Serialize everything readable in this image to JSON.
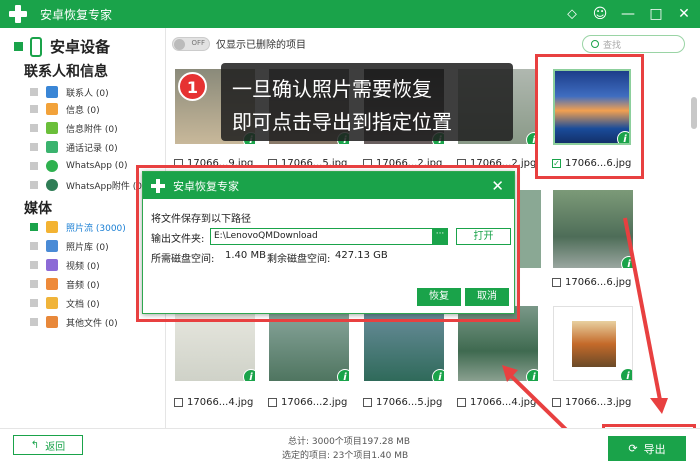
{
  "window": {
    "title": "安卓恢复专家",
    "controls": [
      "⬦",
      "☺",
      "—",
      "□",
      "✕"
    ]
  },
  "sidebar": {
    "device": "安卓设备",
    "group_contacts": "联系人和信息",
    "group_media": "媒体",
    "items": [
      {
        "label": "联系人 (0)",
        "color": "#3a86d6"
      },
      {
        "label": "信息 (0)",
        "color": "#f2a23a"
      },
      {
        "label": "信息附件 (0)",
        "color": "#6bbf3a"
      },
      {
        "label": "通话记录 (0)",
        "color": "#3ab36e"
      },
      {
        "label": "WhatsApp (0)",
        "color": "#2eb14f"
      },
      {
        "label": "WhatsApp附件 (0)",
        "color": "#2f7d56"
      },
      {
        "label": "照片流 (3000)",
        "color": "#f3b332"
      },
      {
        "label": "照片库 (0)",
        "color": "#4a8bd6"
      },
      {
        "label": "视频 (0)",
        "color": "#8c6ad6"
      },
      {
        "label": "音频 (0)",
        "color": "#ee8a3a"
      },
      {
        "label": "文档 (0)",
        "color": "#f0b43a"
      },
      {
        "label": "其他文件 (0)",
        "color": "#e8883a"
      }
    ]
  },
  "toolbar": {
    "toggle_state": "OFF",
    "toggle_label": "仅显示已删除的项目",
    "search_placeholder": "查找"
  },
  "grid": {
    "row1": [
      "17066...9.jpg",
      "17066...5.jpg",
      "17066...2.jpg",
      "17066...2.jpg",
      "17066...6.jpg"
    ],
    "row2": [
      "17066...6.jpg"
    ],
    "row3": [
      "17066...4.jpg",
      "17066...2.jpg",
      "17066...5.jpg",
      "17066...4.jpg",
      "17066...3.jpg"
    ],
    "info_glyph": "i"
  },
  "tip": {
    "number": "1",
    "line1": "一旦确认照片需要恢复",
    "line2": "即可点击导出到指定位置"
  },
  "dialog": {
    "title": "安卓恢复专家",
    "prompt": "将文件保存到以下路径",
    "folder_label": "输出文件夹:",
    "folder_value": "E:\\LenovoQMDownload",
    "browse": "···",
    "open": "打开",
    "space_needed_label": "所需磁盘空间:",
    "space_needed": "1.40 MB",
    "space_free_label": "剩余磁盘空间:",
    "space_free": "427.13 GB",
    "recover": "恢复",
    "cancel": "取消"
  },
  "footer": {
    "back": "返回",
    "total": "总计: 3000个项目197.28 MB",
    "selected": "选定的项目: 23个项目1.40 MB",
    "export": "导出"
  }
}
